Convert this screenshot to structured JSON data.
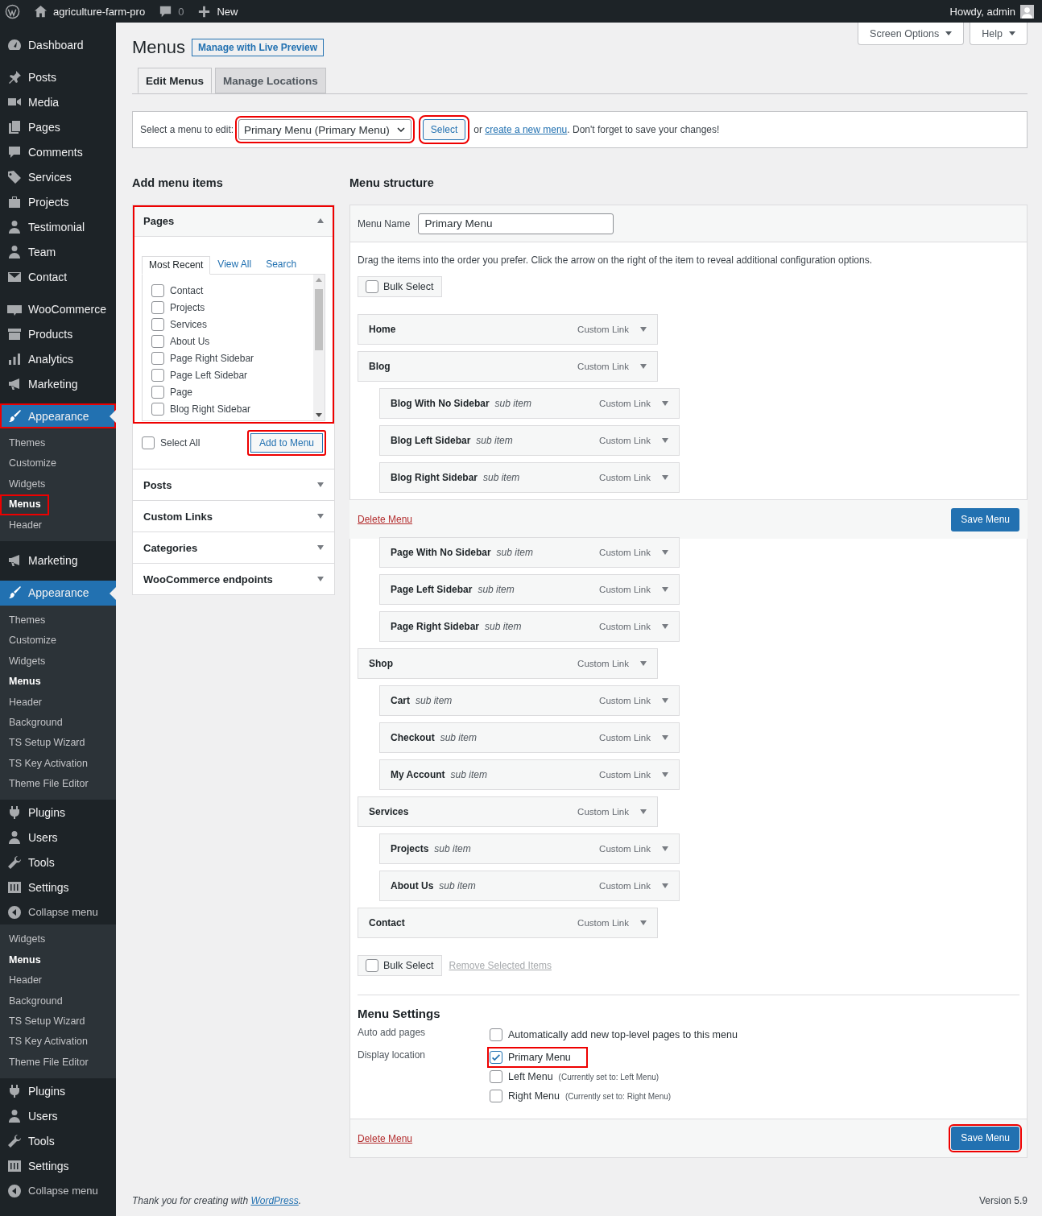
{
  "admin_bar": {
    "site_name": "agriculture-farm-pro",
    "comments_count": "0",
    "new_label": "New",
    "greeting": "Howdy, admin"
  },
  "sidebar": {
    "groups": [
      {
        "items": [
          {
            "label": "Dashboard",
            "kind": "main",
            "current": false,
            "annotated": false
          }
        ]
      },
      {
        "items": [
          {
            "label": "Posts",
            "kind": "main",
            "current": false,
            "annotated": false
          },
          {
            "label": "Media",
            "kind": "main",
            "current": false,
            "annotated": false
          },
          {
            "label": "Pages",
            "kind": "main",
            "current": false,
            "annotated": false
          },
          {
            "label": "Comments",
            "kind": "main",
            "current": false,
            "annotated": false
          },
          {
            "label": "Services",
            "kind": "main",
            "current": false,
            "annotated": false
          },
          {
            "label": "Projects",
            "kind": "main",
            "current": false,
            "annotated": false
          },
          {
            "label": "Testimonial",
            "kind": "main",
            "current": false,
            "annotated": false
          },
          {
            "label": "Team",
            "kind": "main",
            "current": false,
            "annotated": false
          },
          {
            "label": "Contact",
            "kind": "main",
            "current": false,
            "annotated": false
          }
        ]
      },
      {
        "items": [
          {
            "label": "WooCommerce",
            "kind": "main",
            "current": false,
            "annotated": false
          },
          {
            "label": "Products",
            "kind": "main",
            "current": false,
            "annotated": false
          },
          {
            "label": "Analytics",
            "kind": "main",
            "current": false,
            "annotated": false
          },
          {
            "label": "Marketing",
            "kind": "main",
            "current": false,
            "annotated": false
          }
        ]
      },
      {
        "items": [
          {
            "label": "Appearance",
            "kind": "main",
            "current": true,
            "annotated": true
          },
          {
            "label": "Themes",
            "kind": "sub",
            "current": false,
            "annotated": false
          },
          {
            "label": "Customize",
            "kind": "sub",
            "current": false,
            "annotated": false
          },
          {
            "label": "Widgets",
            "kind": "sub",
            "current": false,
            "annotated": false
          },
          {
            "label": "Menus",
            "kind": "sub",
            "current": true,
            "annotated": true
          },
          {
            "label": "Header",
            "kind": "sub",
            "current": false,
            "annotated": false
          }
        ]
      },
      {
        "items": [
          {
            "label": "Marketing",
            "kind": "main",
            "current": false,
            "annotated": false
          }
        ]
      },
      {
        "items": [
          {
            "label": "Appearance",
            "kind": "main",
            "current": true,
            "annotated": false
          },
          {
            "label": "Themes",
            "kind": "sub",
            "current": false,
            "annotated": false
          },
          {
            "label": "Customize",
            "kind": "sub",
            "current": false,
            "annotated": false
          },
          {
            "label": "Widgets",
            "kind": "sub",
            "current": false,
            "annotated": false
          },
          {
            "label": "Menus",
            "kind": "sub",
            "current": true,
            "annotated": false
          },
          {
            "label": "Header",
            "kind": "sub",
            "current": false,
            "annotated": false
          },
          {
            "label": "Background",
            "kind": "sub",
            "current": false,
            "annotated": false
          },
          {
            "label": "TS Setup Wizard",
            "kind": "sub",
            "current": false,
            "annotated": false
          },
          {
            "label": "TS Key Activation",
            "kind": "sub",
            "current": false,
            "annotated": false
          },
          {
            "label": "Theme File Editor",
            "kind": "sub",
            "current": false,
            "annotated": false
          },
          {
            "label": "Plugins",
            "kind": "main",
            "current": false,
            "annotated": false
          },
          {
            "label": "Users",
            "kind": "main",
            "current": false,
            "annotated": false
          },
          {
            "label": "Tools",
            "kind": "main",
            "current": false,
            "annotated": false
          },
          {
            "label": "Settings",
            "kind": "main",
            "current": false,
            "annotated": false
          },
          {
            "label": "Collapse menu",
            "kind": "collapse",
            "current": false,
            "annotated": false
          },
          {
            "label": "Widgets",
            "kind": "sub",
            "current": false,
            "annotated": false
          },
          {
            "label": "Menus",
            "kind": "sub",
            "current": true,
            "annotated": false
          },
          {
            "label": "Header",
            "kind": "sub",
            "current": false,
            "annotated": false
          },
          {
            "label": "Background",
            "kind": "sub",
            "current": false,
            "annotated": false
          },
          {
            "label": "TS Setup Wizard",
            "kind": "sub",
            "current": false,
            "annotated": false
          },
          {
            "label": "TS Key Activation",
            "kind": "sub",
            "current": false,
            "annotated": false
          },
          {
            "label": "Theme File Editor",
            "kind": "sub",
            "current": false,
            "annotated": false
          },
          {
            "label": "Plugins",
            "kind": "main",
            "current": false,
            "annotated": false
          },
          {
            "label": "Users",
            "kind": "main",
            "current": false,
            "annotated": false
          },
          {
            "label": "Tools",
            "kind": "main",
            "current": false,
            "annotated": false
          },
          {
            "label": "Settings",
            "kind": "main",
            "current": false,
            "annotated": false
          },
          {
            "label": "Collapse menu",
            "kind": "collapse",
            "current": false,
            "annotated": false
          }
        ]
      }
    ]
  },
  "screen_meta": [
    {
      "label": "Screen Options"
    },
    {
      "label": "Help"
    }
  ],
  "page": {
    "title": "Menus",
    "live_preview_label": "Manage with Live Preview"
  },
  "tabs": [
    {
      "label": "Edit Menus",
      "selected": true
    },
    {
      "label": "Manage Locations",
      "selected": false
    }
  ],
  "menu_picker": {
    "label": "Select a menu to edit:",
    "value": "Primary Menu (Primary Menu)",
    "value_annotated": true,
    "button_label": "Select",
    "button_annotated": true,
    "or_text": "or ",
    "create_link": "create a new menu",
    "after_text": ". Don't forget to save your changes!"
  },
  "add_items": {
    "heading": "Add menu items",
    "sections": [
      {
        "title": "Pages",
        "expanded": true,
        "annotated": true,
        "tabs": [
          {
            "label": "Most Recent",
            "selected": true
          },
          {
            "label": "View All",
            "selected": false
          },
          {
            "label": "Search",
            "selected": false
          }
        ],
        "items": [
          {
            "label": "Contact",
            "checked": false
          },
          {
            "label": "Projects",
            "checked": false
          },
          {
            "label": "Services",
            "checked": false
          },
          {
            "label": "About Us",
            "checked": false
          },
          {
            "label": "Page Right Sidebar",
            "checked": false
          },
          {
            "label": "Page Left Sidebar",
            "checked": false
          },
          {
            "label": "Page",
            "checked": false
          },
          {
            "label": "Blog Right Sidebar",
            "checked": false
          }
        ],
        "select_all": {
          "label": "Select All",
          "checked": false
        },
        "add_button": {
          "label": "Add to Menu",
          "annotated": true
        }
      },
      {
        "title": "Posts",
        "expanded": false,
        "annotated": false
      },
      {
        "title": "Custom Links",
        "expanded": false,
        "annotated": false
      },
      {
        "title": "Categories",
        "expanded": false,
        "annotated": false
      },
      {
        "title": "WooCommerce endpoints",
        "expanded": false,
        "annotated": false
      }
    ]
  },
  "menu_structure": {
    "heading": "Menu structure",
    "name_label": "Menu Name",
    "name_value": "Primary Menu",
    "instructions": "Drag the items into the order you prefer. Click the arrow on the right of the item to reveal additional configuration options.",
    "bulk_select": {
      "label": "Bulk Select",
      "checked": false
    },
    "blocks": [
      {
        "kind": "items",
        "items": [
          {
            "title": "Home",
            "type": "Custom Link"
          },
          {
            "title": "Blog",
            "type": "Custom Link",
            "children": [
              {
                "title": "Blog With No Sidebar",
                "note": "sub item",
                "type": "Custom Link"
              },
              {
                "title": "Blog Left Sidebar",
                "note": "sub item",
                "type": "Custom Link"
              },
              {
                "title": "Blog Right Sidebar",
                "note": "sub item",
                "type": "Custom Link"
              }
            ]
          }
        ]
      },
      {
        "kind": "footer",
        "delete_label": "Delete Menu",
        "save_label": "Save Menu",
        "annotated": false
      },
      {
        "kind": "items",
        "items": [
          {
            "children": [
              {
                "title": "Page With No Sidebar",
                "note": "sub item",
                "type": "Custom Link"
              },
              {
                "title": "Page Left Sidebar",
                "note": "sub item",
                "type": "Custom Link"
              },
              {
                "title": "Page Right Sidebar",
                "note": "sub item",
                "type": "Custom Link"
              }
            ]
          },
          {
            "title": "Shop",
            "type": "Custom Link",
            "children": [
              {
                "title": "Cart",
                "note": "sub item",
                "type": "Custom Link"
              },
              {
                "title": "Checkout",
                "note": "sub item",
                "type": "Custom Link"
              },
              {
                "title": "My Account",
                "note": "sub item",
                "type": "Custom Link"
              }
            ]
          },
          {
            "title": "Services",
            "type": "Custom Link",
            "children": [
              {
                "title": "Projects",
                "note": "sub item",
                "type": "Custom Link"
              },
              {
                "title": "About Us",
                "note": "sub item",
                "type": "Custom Link"
              }
            ]
          },
          {
            "title": "Contact",
            "type": "Custom Link"
          }
        ]
      }
    ],
    "bottom_bulk": {
      "label": "Bulk Select",
      "checked": false,
      "remove_label": "Remove Selected Items"
    },
    "settings": {
      "heading": "Menu Settings",
      "rows": [
        {
          "label": "Auto add pages",
          "options": [
            {
              "label": "Automatically add new top-level pages to this menu",
              "checked": false,
              "annotated": false
            }
          ]
        },
        {
          "label": "Display location",
          "options": [
            {
              "label": "Primary Menu",
              "checked": true,
              "annotated": true
            },
            {
              "label": "Left Menu",
              "note": "(Currently set to: Left Menu)",
              "checked": false,
              "annotated": false
            },
            {
              "label": "Right Menu",
              "note": "(Currently set to: Right Menu)",
              "checked": false,
              "annotated": false
            }
          ]
        }
      ]
    },
    "footer": {
      "delete_label": "Delete Menu",
      "save_label": "Save Menu",
      "annotated": true
    }
  },
  "footer": {
    "text_before": "Thank you for creating with ",
    "link": "WordPress",
    "text_after": ".",
    "version": "Version 5.9"
  }
}
